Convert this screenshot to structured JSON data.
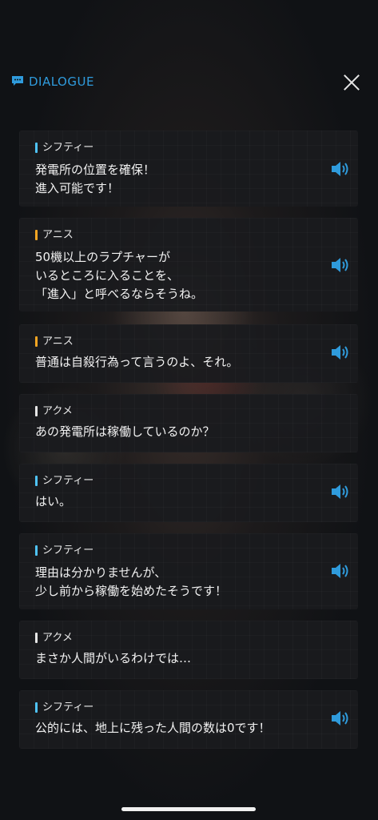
{
  "header": {
    "title": "DIALOGUE",
    "accent_color": "#2f9bdc",
    "icon": "chat-bubble-icon",
    "close_icon": "close-icon"
  },
  "colors": {
    "shifty": "#4fc3f7",
    "anis": "#f5a623",
    "akume": "#e6e6e6",
    "voice": "#2f9bdc"
  },
  "dialogue": [
    {
      "speaker": "シフティー",
      "lines": [
        "発電所の位置を確保！",
        "進入可能です！"
      ],
      "has_voice": true
    },
    {
      "speaker": "アニス",
      "lines": [
        "50機以上のラプチャーが",
        "いるところに入ることを、",
        "「進入」と呼べるならそうね。"
      ],
      "has_voice": true
    },
    {
      "speaker": "アニス",
      "lines": [
        "普通は自殺行為って言うのよ、それ。"
      ],
      "has_voice": true
    },
    {
      "speaker": "アクメ",
      "lines": [
        "あの発電所は稼働しているのか？"
      ],
      "has_voice": false
    },
    {
      "speaker": "シフティー",
      "lines": [
        "はい。"
      ],
      "has_voice": true
    },
    {
      "speaker": "シフティー",
      "lines": [
        "理由は分かりませんが、",
        "少し前から稼働を始めたそうです！"
      ],
      "has_voice": true
    },
    {
      "speaker": "アクメ",
      "lines": [
        "まさか人間がいるわけでは…"
      ],
      "has_voice": false
    },
    {
      "speaker": "シフティー",
      "lines": [
        "公的には、地上に残った人間の数は0です！"
      ],
      "has_voice": true
    }
  ]
}
